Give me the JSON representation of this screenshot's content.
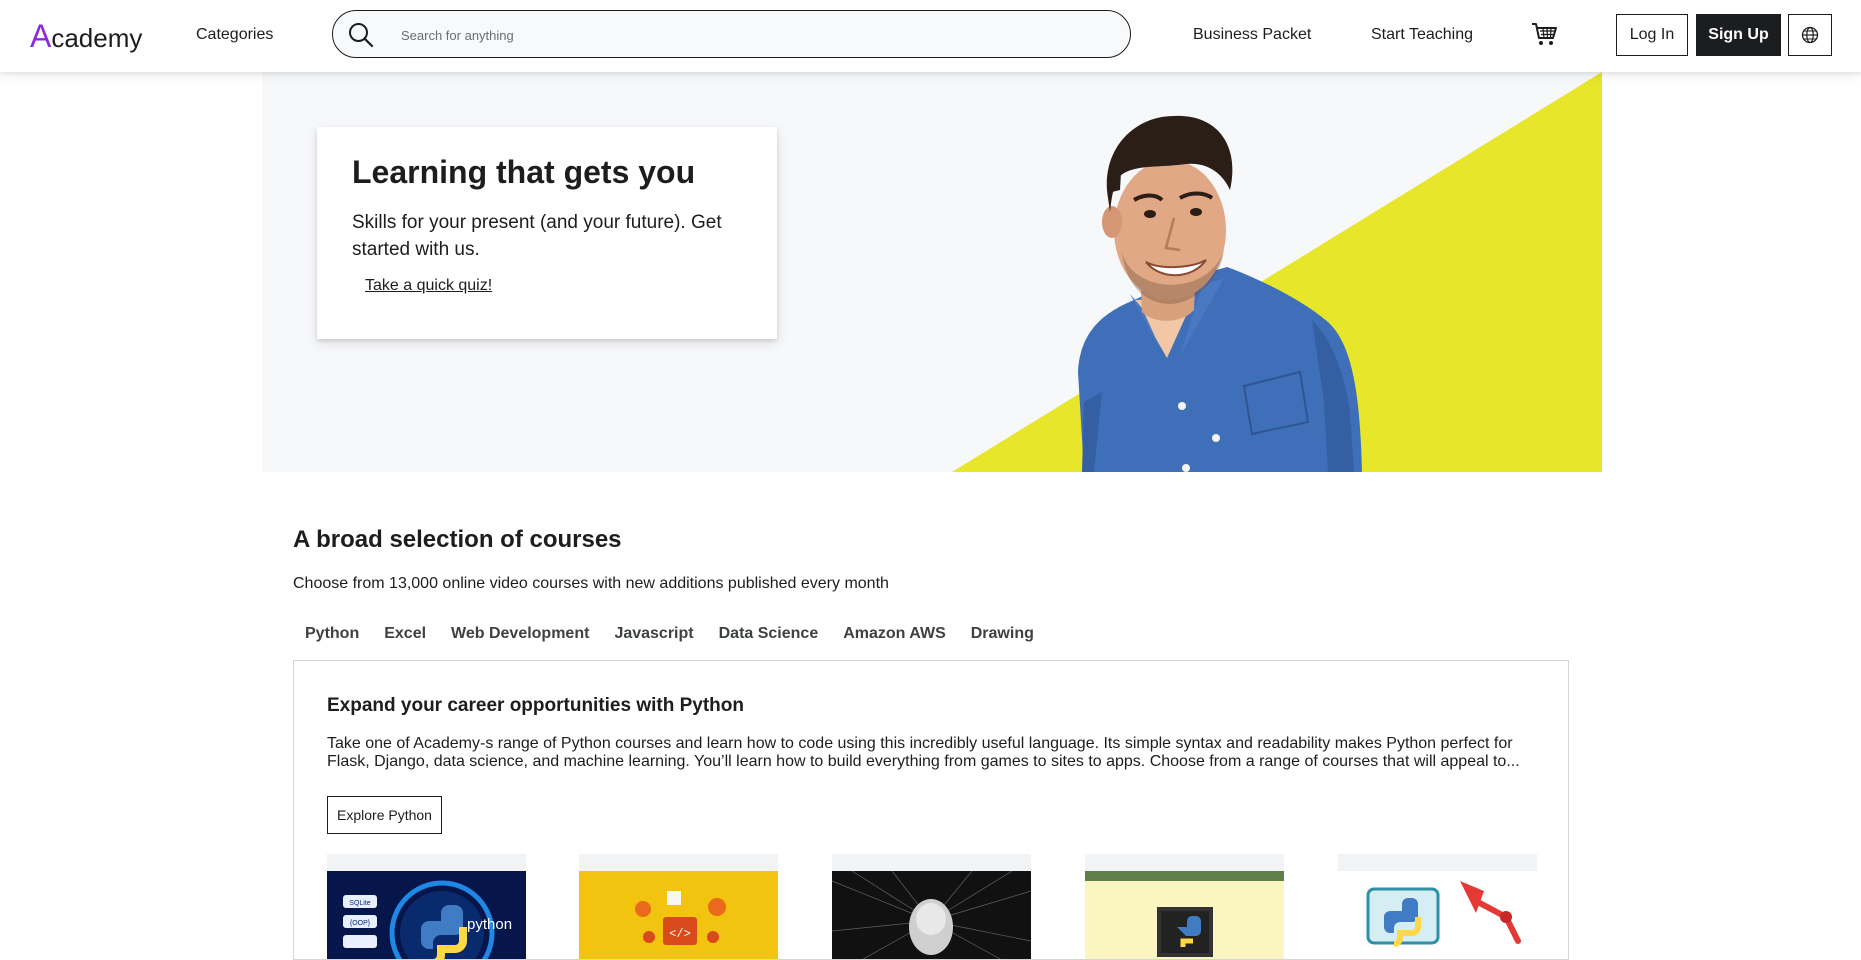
{
  "header": {
    "logo_initial": "A",
    "logo_rest": "cademy",
    "categories": "Categories",
    "search_placeholder": "Search for anything",
    "business": "Business Packet",
    "teach": "Start Teaching",
    "login": "Log In",
    "signup": "Sign Up"
  },
  "hero": {
    "title": "Learning that gets you",
    "subtitle": "Skills for your present (and your future). Get started with us.",
    "link": "Take a quick quiz!"
  },
  "courses": {
    "title": "A broad selection of courses",
    "subtitle": "Choose from 13,000 online video courses with new additions published every month",
    "tabs": [
      "Python",
      "Excel",
      "Web Development",
      "Javascript",
      "Data Science",
      "Amazon AWS",
      "Drawing"
    ],
    "panel": {
      "title": "Expand your career opportunities with Python",
      "description": "Take one of Academy-s range of Python courses and learn how to code using this incredibly useful language. Its simple syntax and readability makes Python perfect for Flask, Django, data science, and machine learning. You’ll learn how to build everything from games to sites to apps. Choose from a range of courses that will appeal to...",
      "button": "Explore Python"
    },
    "thumb1_badges": [
      "SQLite",
      "{OOP}"
    ],
    "thumb1_label": "python"
  },
  "colors": {
    "accent": "#8a2be2",
    "hero_yellow": "#e8e62a",
    "shirt_blue": "#3f6fb8",
    "dark": "#1c1d1f"
  },
  "icons": [
    "search-icon",
    "cart-icon",
    "globe-icon",
    "python-logo-icon"
  ]
}
